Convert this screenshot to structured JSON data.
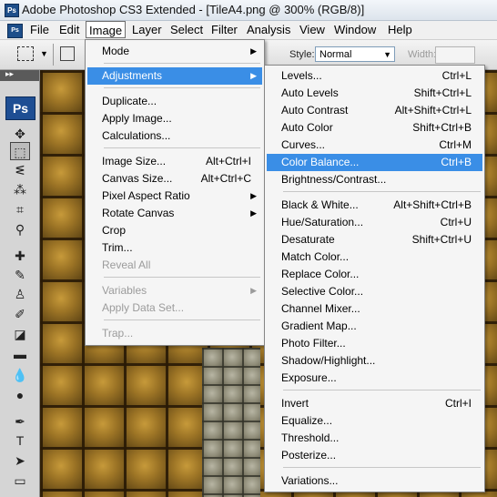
{
  "title_bar": {
    "title": "Adobe Photoshop CS3 Extended - [TileA4.png @ 300% (RGB/8)]",
    "icon": "Ps"
  },
  "menu_bar": {
    "icon": "Ps",
    "items": [
      "File",
      "Edit",
      "Image",
      "Layer",
      "Select",
      "Filter",
      "Analysis",
      "View",
      "Window",
      "Help"
    ],
    "active": "Image"
  },
  "options_bar": {
    "style_label": "Style:",
    "style_value": "Normal",
    "width_label": "Width:"
  },
  "toolbox": {
    "header": "▸▸",
    "logo": "Ps"
  },
  "image_menu": {
    "items": [
      {
        "label": "Mode",
        "submenu": true
      },
      {
        "label": "Adjustments",
        "submenu": true,
        "highlighted": true
      },
      {
        "label": "Duplicate..."
      },
      {
        "label": "Apply Image..."
      },
      {
        "label": "Calculations..."
      },
      {
        "label": "Image Size...",
        "shortcut": "Alt+Ctrl+I"
      },
      {
        "label": "Canvas Size...",
        "shortcut": "Alt+Ctrl+C"
      },
      {
        "label": "Pixel Aspect Ratio",
        "submenu": true
      },
      {
        "label": "Rotate Canvas",
        "submenu": true
      },
      {
        "label": "Crop"
      },
      {
        "label": "Trim..."
      },
      {
        "label": "Reveal All",
        "disabled": true
      },
      {
        "label": "Variables",
        "submenu": true,
        "disabled": true
      },
      {
        "label": "Apply Data Set...",
        "disabled": true
      },
      {
        "label": "Trap...",
        "disabled": true
      }
    ]
  },
  "adjustments_menu": {
    "items": [
      {
        "label": "Levels...",
        "shortcut": "Ctrl+L"
      },
      {
        "label": "Auto Levels",
        "shortcut": "Shift+Ctrl+L"
      },
      {
        "label": "Auto Contrast",
        "shortcut": "Alt+Shift+Ctrl+L"
      },
      {
        "label": "Auto Color",
        "shortcut": "Shift+Ctrl+B"
      },
      {
        "label": "Curves...",
        "shortcut": "Ctrl+M"
      },
      {
        "label": "Color Balance...",
        "shortcut": "Ctrl+B",
        "highlighted": true
      },
      {
        "label": "Brightness/Contrast..."
      },
      {
        "label": "Black & White...",
        "shortcut": "Alt+Shift+Ctrl+B"
      },
      {
        "label": "Hue/Saturation...",
        "shortcut": "Ctrl+U"
      },
      {
        "label": "Desaturate",
        "shortcut": "Shift+Ctrl+U"
      },
      {
        "label": "Match Color..."
      },
      {
        "label": "Replace Color..."
      },
      {
        "label": "Selective Color..."
      },
      {
        "label": "Channel Mixer..."
      },
      {
        "label": "Gradient Map..."
      },
      {
        "label": "Photo Filter..."
      },
      {
        "label": "Shadow/Highlight..."
      },
      {
        "label": "Exposure..."
      },
      {
        "label": "Invert",
        "shortcut": "Ctrl+I"
      },
      {
        "label": "Equalize..."
      },
      {
        "label": "Threshold..."
      },
      {
        "label": "Posterize..."
      },
      {
        "label": "Variations..."
      }
    ]
  },
  "colors": {
    "highlight": "#3a8ee6",
    "disabled": "#9b9b9b",
    "menu_bg": "#f5f5f5"
  }
}
